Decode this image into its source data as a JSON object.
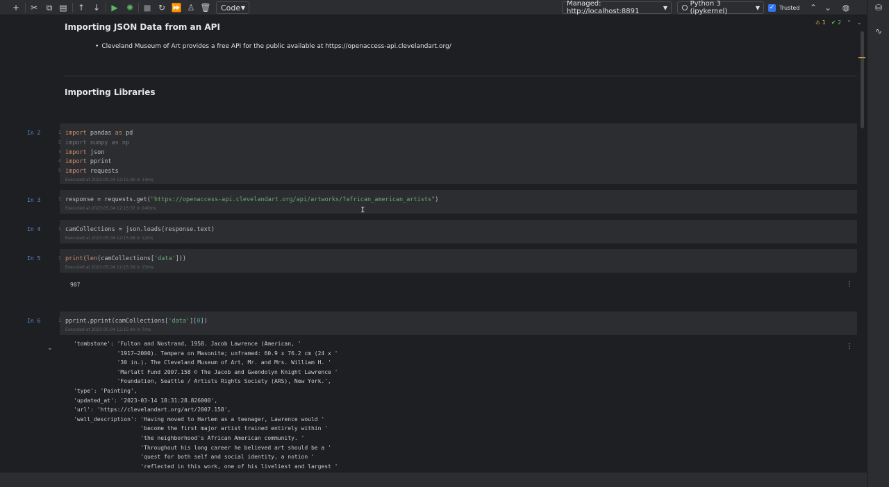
{
  "toolbar": {
    "cell_type": "Code",
    "server_label": "Managed: http://localhost:8891",
    "kernel_label": "Python 3 (ipykernel)",
    "trusted_label": "Trusted",
    "icons": [
      "add-icon",
      "cut-icon",
      "copy-icon",
      "paste-icon",
      "move-up-icon",
      "move-down-icon",
      "run-cell-icon",
      "debug-icon",
      "stop-icon",
      "restart-icon",
      "run-all-icon",
      "clear-icon",
      "delete-icon",
      "chevron-up-icon",
      "chevron-down-icon",
      "globe-icon"
    ]
  },
  "inspections": {
    "warnings": "1",
    "ok": "2"
  },
  "markdown": {
    "h1": "Importing JSON Data from an API",
    "bullet": "Cleveland Museum of Art provides a free API for the public available at https://openaccess-api.clevelandart.org/",
    "h2": "Importing Libraries"
  },
  "cells": [
    {
      "prompt": "In 2",
      "lines": [
        {
          "n": "1",
          "kw": "import",
          "rest": " pandas ",
          "kw2": "as",
          "rest2": " pd"
        },
        {
          "n": "2",
          "dim": "import numpy as np"
        },
        {
          "n": "3",
          "kw": "import",
          "rest": " json"
        },
        {
          "n": "4",
          "kw": "import",
          "rest": " pprint"
        },
        {
          "n": "5",
          "kw": "import",
          "rest": " requests"
        }
      ],
      "exec": "Executed at 2023.05.04 12:15:36 in 14ms"
    },
    {
      "prompt": "In 3",
      "code_pre": "response = requests.get(",
      "code_str": "\"https://openaccess-api.clevelandart.org/api/artworks/?african_american_artists\"",
      "code_post": ")",
      "exec": "Executed at 2023.05.04 12:15:37 in 240ms"
    },
    {
      "prompt": "In 4",
      "code": "camCollections = json.loads(response.text)",
      "exec": "Executed at 2023.05.04 12:15:38 in 12ms"
    },
    {
      "prompt": "In 5",
      "code_fn": "print",
      "code_a": "(",
      "code_fn2": "len",
      "code_b": "(camCollections[",
      "code_str": "'data'",
      "code_c": "]))",
      "exec": "Executed at 2023.05.04 12:15:39 in 15ms",
      "output": "907"
    },
    {
      "prompt": "In 6",
      "code_pre": "pprint.pprint(camCollections[",
      "code_str": "'data'",
      "code_mid": "][",
      "code_num": "0",
      "code_post": "])",
      "exec": "Executed at 2023.05.04 12:15:40 in 7ms",
      "output_lines": [
        "'tombstone': 'Fulton and Nostrand, 1958. Jacob Lawrence (American, '",
        "             '1917–2000). Tempera on Masonite; unframed: 60.9 x 76.2 cm (24 x '",
        "             '30 in.). The Cleveland Museum of Art, Mr. and Mrs. William H. '",
        "             'Marlatt Fund 2007.158 © The Jacob and Gwendolyn Knight Lawrence '",
        "             'Foundation, Seattle / Artists Rights Society (ARS), New York.',",
        "'type': 'Painting',",
        "'updated_at': '2023-03-14 18:31:28.826000',",
        "'url': 'https://clevelandart.org/art/2007.158',",
        "'wall_description': 'Having moved to Harlem as a teenager, Lawrence would '",
        "                    'become the first major artist trained entirely within '",
        "                    'the neighborhood's African American community. '",
        "                    'Throughout his long career he believed art should be a '",
        "                    'quest for both self and social identity, a notion '",
        "                    'reflected in this work, one of his liveliest and largest '"
      ]
    }
  ]
}
